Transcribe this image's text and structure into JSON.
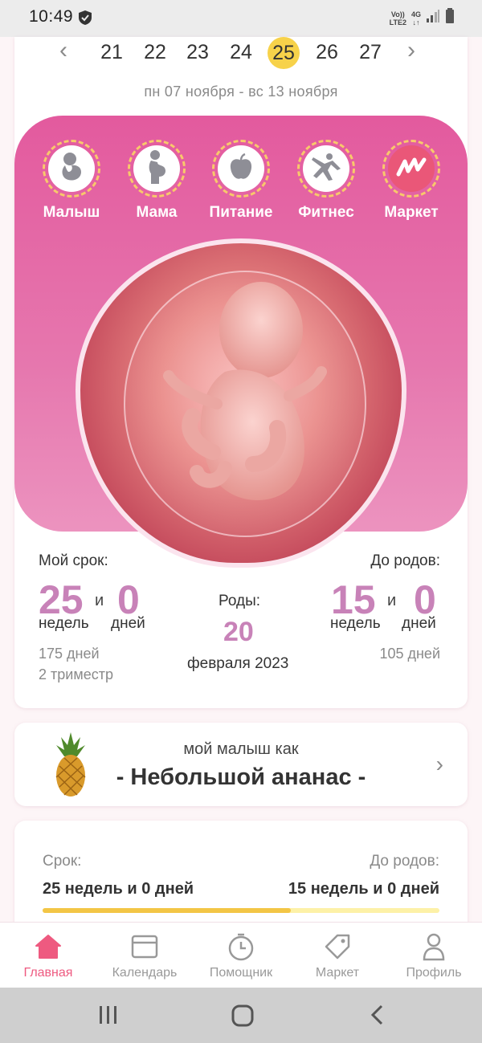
{
  "status_bar": {
    "time": "10:49",
    "volte_top": "Vo))",
    "volte_bottom": "LTE2",
    "network": "4G"
  },
  "week_selector": {
    "weeks": [
      "21",
      "22",
      "23",
      "24",
      "25",
      "26",
      "27"
    ],
    "selected_week": "25",
    "date_range": "пн 07 ноября - вс 13 ноября"
  },
  "categories": [
    {
      "label": "Малыш",
      "icon": "baby-icon"
    },
    {
      "label": "Мама",
      "icon": "pregnant-mother-icon"
    },
    {
      "label": "Питание",
      "icon": "apple-icon"
    },
    {
      "label": "Фитнес",
      "icon": "fitness-icon"
    },
    {
      "label": "Маркет",
      "icon": "market-logo-icon"
    }
  ],
  "term": {
    "label": "Мой срок:",
    "weeks": "25",
    "and": "и",
    "days": "0",
    "weeks_unit": "недель",
    "days_unit": "дней",
    "total_days": "175 дней",
    "trimester": "2 триместр"
  },
  "birth": {
    "label": "Роды:",
    "day": "20",
    "month_year": "февраля 2023"
  },
  "until_birth": {
    "label": "До родов:",
    "weeks": "15",
    "and": "и",
    "days": "0",
    "weeks_unit": "недель",
    "days_unit": "дней",
    "total_days": "105 дней"
  },
  "baby_size": {
    "caption": "мой малыш как",
    "title": "- Небольшой ананас -",
    "icon": "pineapple-icon"
  },
  "progress": {
    "term_label": "Срок:",
    "term_value": "25 недель и 0 дней",
    "until_label": "До родов:",
    "until_value": "15 недель и 0 дней",
    "fraction": 0.625
  },
  "bottom_nav": [
    {
      "label": "Главная",
      "icon": "home-icon",
      "active": true
    },
    {
      "label": "Календарь",
      "icon": "calendar-icon",
      "active": false
    },
    {
      "label": "Помощник",
      "icon": "timer-icon",
      "active": false
    },
    {
      "label": "Маркет",
      "icon": "tag-icon",
      "active": false
    },
    {
      "label": "Профиль",
      "icon": "profile-icon",
      "active": false
    }
  ],
  "colors": {
    "accent_pink": "#e35a9e",
    "number_purple": "#c882b8",
    "selected_yellow": "#f7d24a",
    "nav_active": "#ee5a80"
  }
}
